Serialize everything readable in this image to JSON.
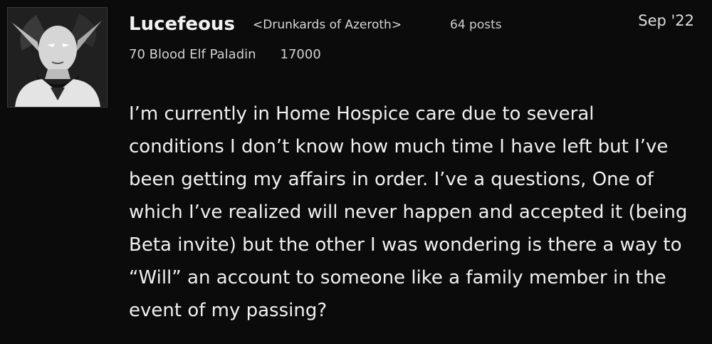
{
  "post": {
    "author": {
      "name": "Lucefeous",
      "guild": "<Drunkards of Azeroth>",
      "posts_count": "64 posts",
      "character": "70 Blood Elf Paladin",
      "achievement_points": "17000",
      "avatar_icon": "blood-elf-avatar-icon"
    },
    "date": "Sep '22",
    "body_lines": [
      "I’m currently in Home Hospice care due to several",
      "conditions I don’t know how much time I have left but I’ve",
      "been getting my affairs in order. I’ve a questions, One of",
      "which I’ve realized will never happen and accepted it (being",
      "Beta invite) but the other I was wondering is there a way to",
      "“Will” an account to someone like a family member in the",
      "event of my passing?"
    ]
  },
  "colors": {
    "background": "#0b0b0b",
    "text": "#f0f0f0",
    "muted_text": "#d2d2d2"
  }
}
